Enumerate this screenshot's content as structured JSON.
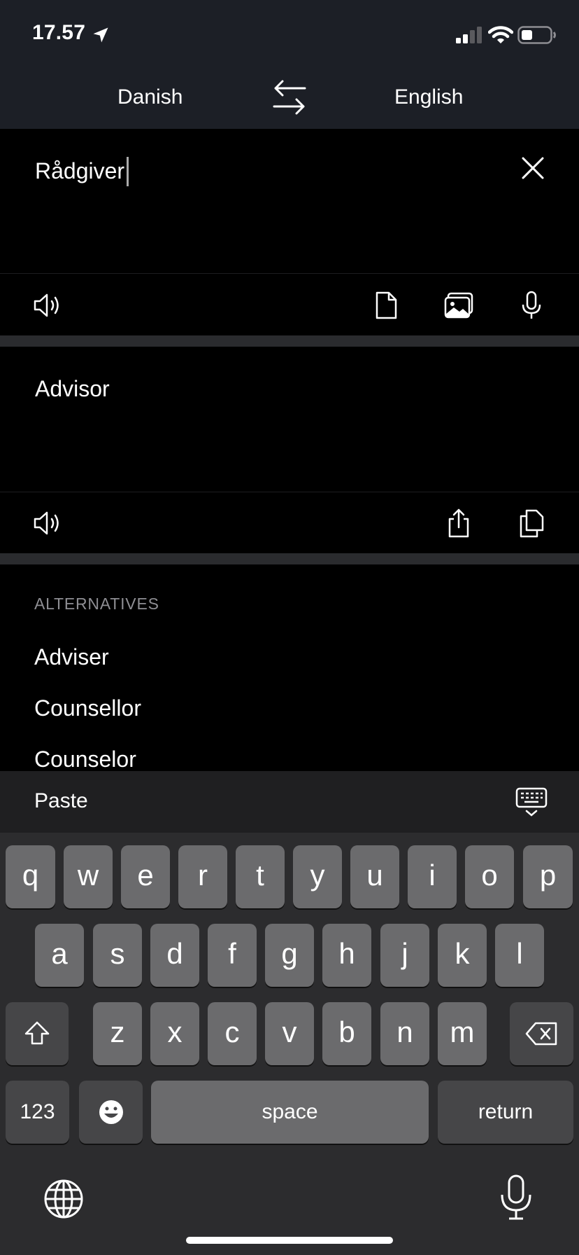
{
  "status": {
    "time": "17.57"
  },
  "header": {
    "source_lang": "Danish",
    "target_lang": "English"
  },
  "input": {
    "text": "Rådgiver"
  },
  "output": {
    "text": "Advisor"
  },
  "alternatives": {
    "heading": "ALTERNATIVES",
    "items": [
      "Adviser",
      "Counsellor",
      "Counselor"
    ]
  },
  "keyboard": {
    "paste": "Paste",
    "row1": [
      "q",
      "w",
      "e",
      "r",
      "t",
      "y",
      "u",
      "i",
      "o",
      "p"
    ],
    "row2": [
      "a",
      "s",
      "d",
      "f",
      "g",
      "h",
      "j",
      "k",
      "l"
    ],
    "row3": [
      "z",
      "x",
      "c",
      "v",
      "b",
      "n",
      "m"
    ],
    "numbers_label": "123",
    "space_label": "space",
    "return_label": "return"
  },
  "icons": {
    "location": "location-arrow-icon",
    "signal": "signal-icon",
    "wifi": "wifi-icon",
    "battery": "battery-icon",
    "swap": "swap-languages-icon",
    "clear": "close-icon",
    "speaker": "speaker-icon",
    "document": "document-icon",
    "image": "image-icon",
    "mic": "microphone-icon",
    "share": "share-icon",
    "copy": "copy-icon",
    "keyboard": "keyboard-hide-icon",
    "shift": "shift-icon",
    "delete": "delete-icon",
    "emoji": "emoji-icon",
    "globe": "globe-icon"
  }
}
